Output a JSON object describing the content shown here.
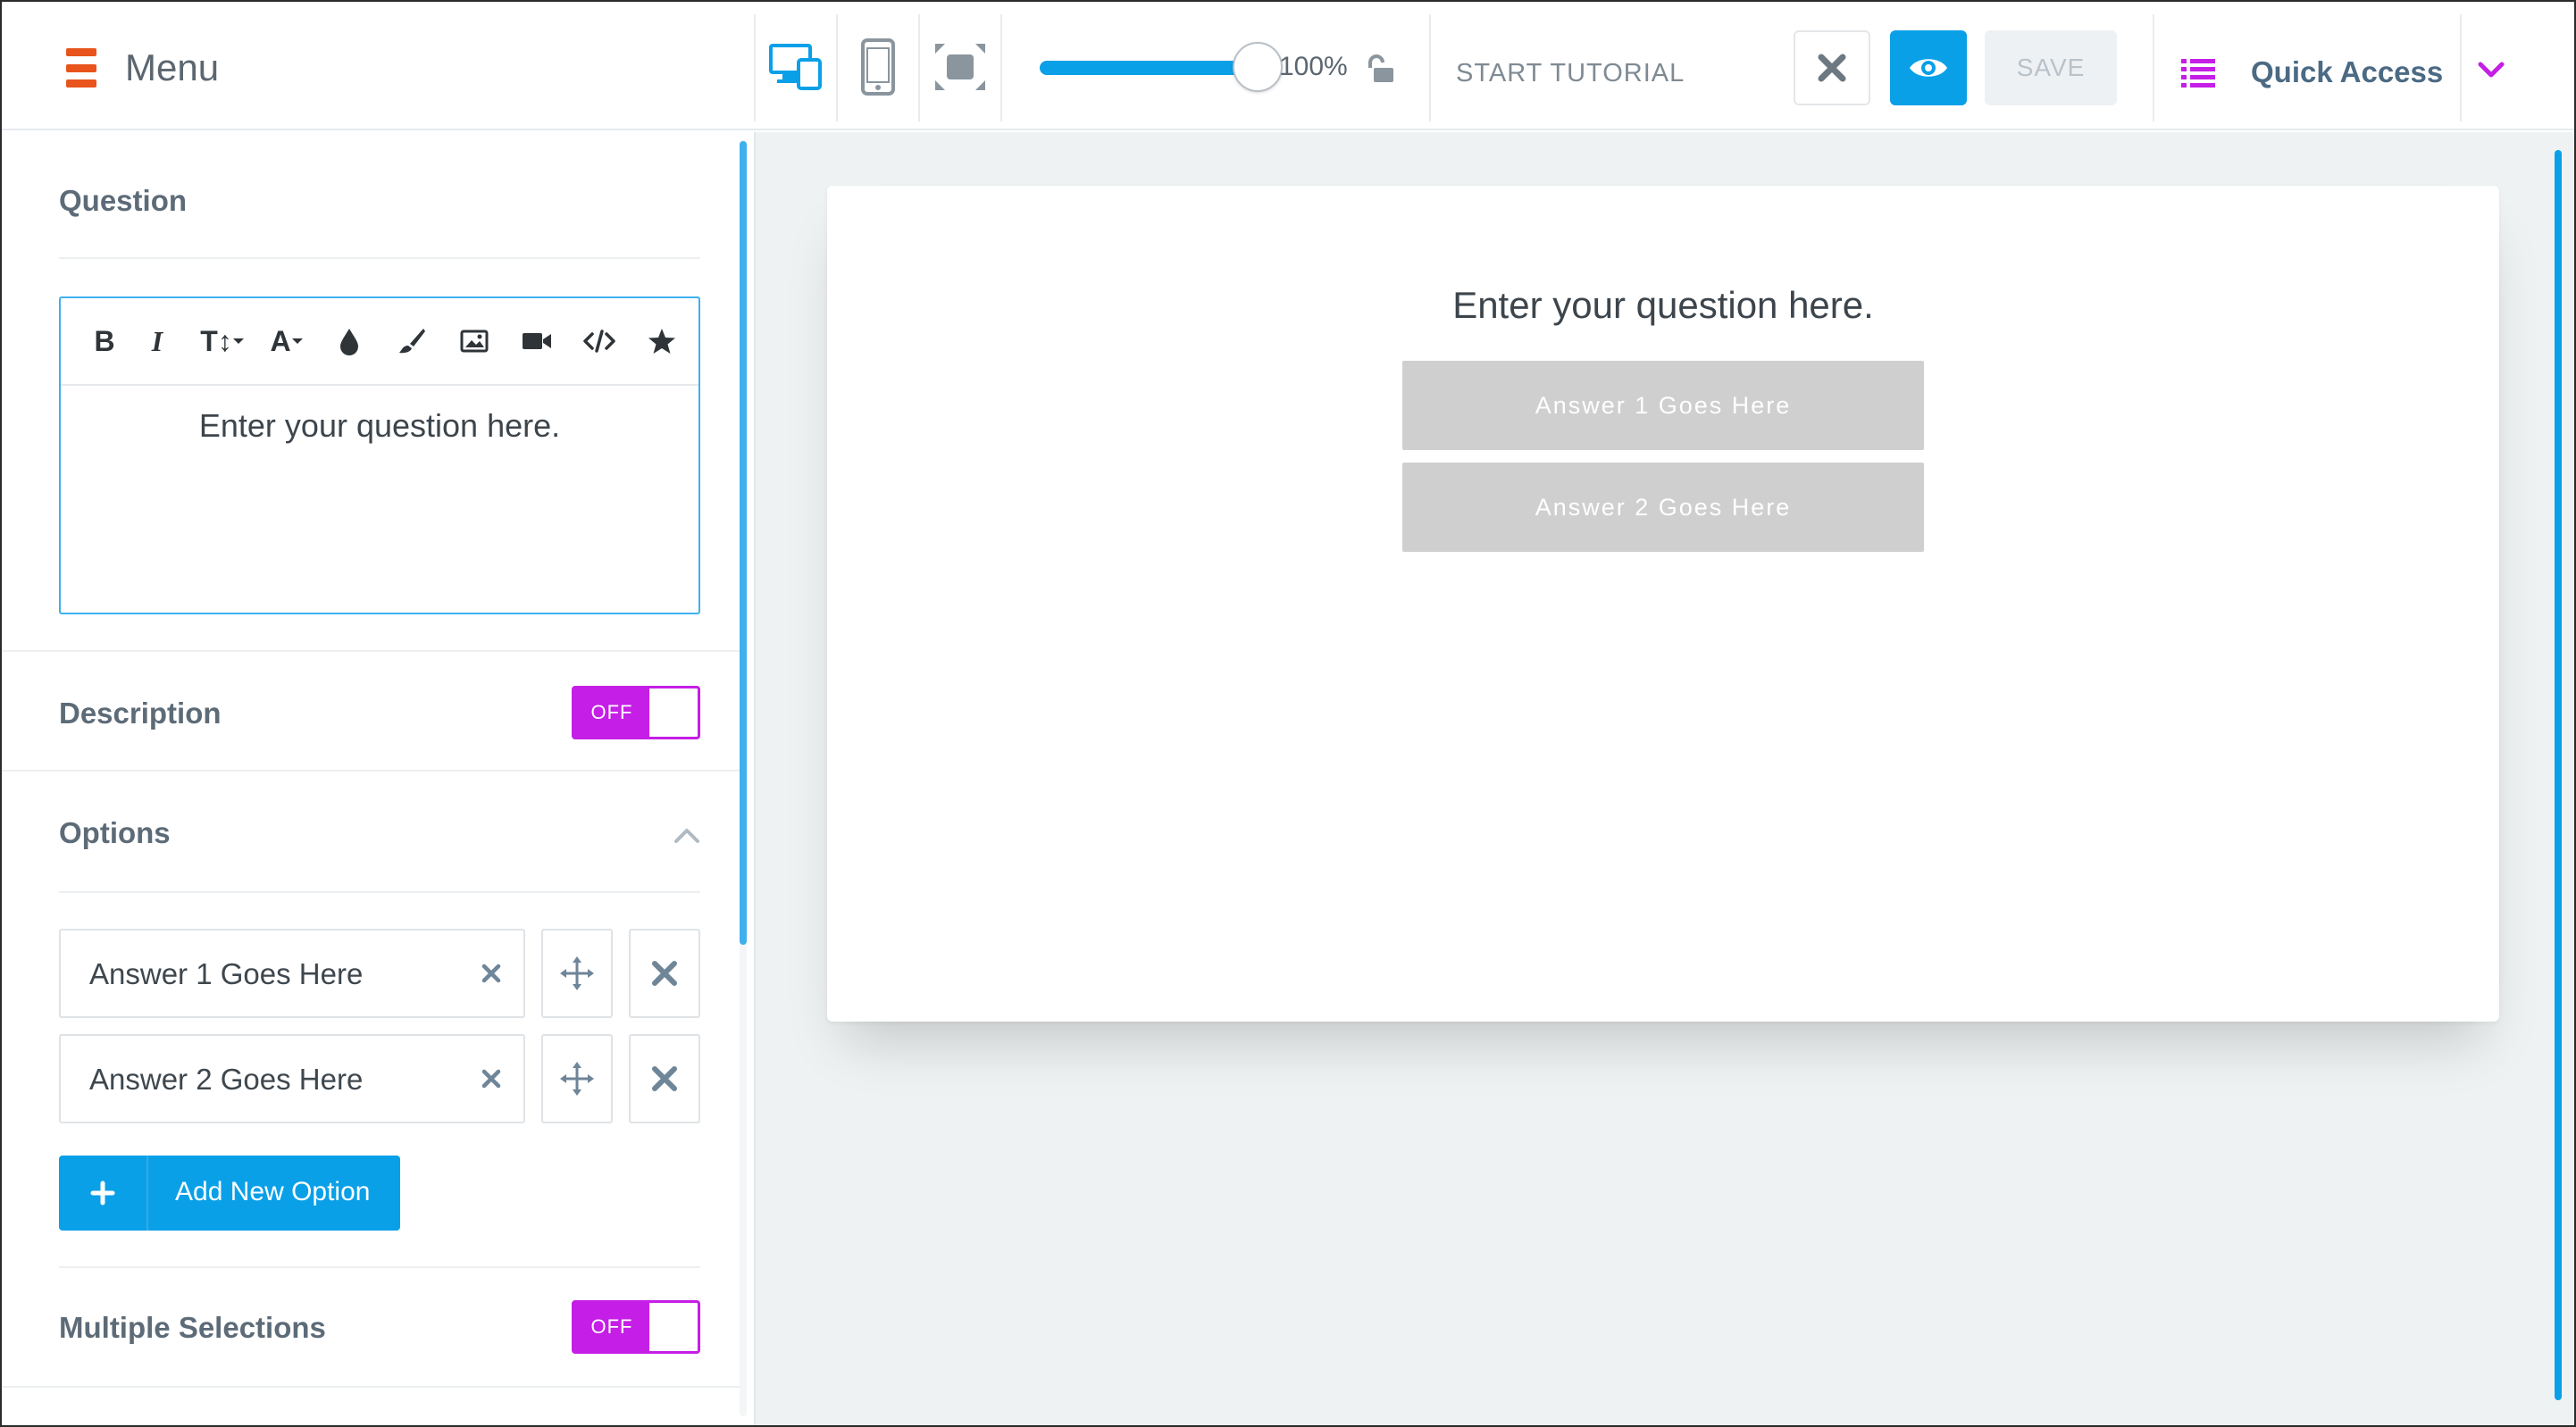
{
  "topbar": {
    "menu_label": "Menu",
    "zoom": {
      "value_percent": 100,
      "label": "100%"
    },
    "tutorial_label": "START TUTORIAL",
    "save_label": "SAVE",
    "quick_access_label": "Quick Access",
    "colors": {
      "accent": "#0aa0e8",
      "menu_icon": "#e8541c",
      "quick_access": "#c51ee6"
    }
  },
  "panel": {
    "question": {
      "title": "Question",
      "toolbar": [
        "bold",
        "italic",
        "text-size",
        "font-color",
        "drop-icon",
        "brush-icon",
        "image-icon",
        "video-icon",
        "code-icon",
        "star-icon"
      ],
      "toolbar_labels": {
        "bold": "B",
        "italic": "I",
        "text_size": "T↕",
        "font": "A"
      },
      "editor_text": "Enter your question here."
    },
    "description": {
      "title": "Description",
      "toggle": "OFF"
    },
    "options": {
      "title": "Options",
      "items": [
        {
          "label": "Answer 1 Goes Here"
        },
        {
          "label": "Answer 2 Goes Here"
        }
      ],
      "add_label": "Add New Option"
    },
    "multiple_selections": {
      "title": "Multiple Selections",
      "toggle": "OFF"
    }
  },
  "canvas": {
    "question_text": "Enter your question here.",
    "answers": [
      "Answer 1 Goes Here",
      "Answer 2 Goes Here"
    ]
  }
}
